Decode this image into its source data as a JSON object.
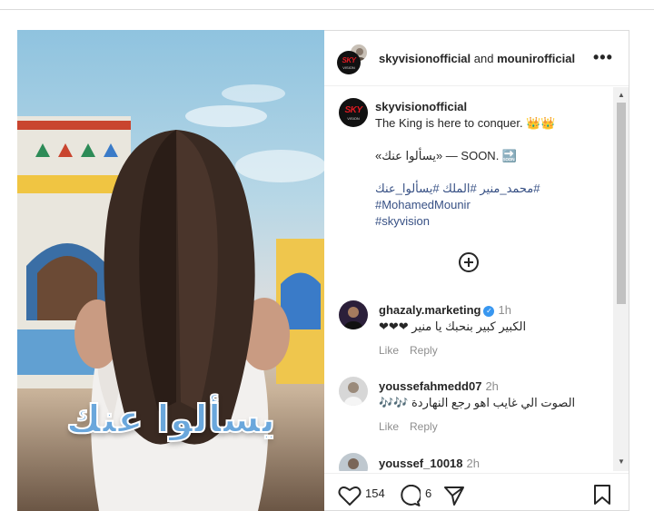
{
  "header": {
    "account_1": "skyvisionofficial",
    "connector": "and",
    "account_2": "mounirofficial",
    "more_icon": "ellipsis-icon"
  },
  "media": {
    "overlay_text": "يسألوا عنك"
  },
  "caption": {
    "username": "skyvisionofficial",
    "line1": "The King is here to conquer. 👑👑",
    "line2": "«يسألوا عنك» — SOON. 🔜",
    "tag1": "#محمد_منير #الملك #يسألوا_عنك",
    "tag2": "#MohamedMounir",
    "tag3": "#skyvision"
  },
  "comments": [
    {
      "username": "ghazaly.marketing",
      "time": "1h",
      "verified": true,
      "text": "الكبير كبير بنحبك يا منير ❤❤❤",
      "like": "Like",
      "reply": "Reply"
    },
    {
      "username": "youssefahmedd07",
      "time": "2h",
      "verified": false,
      "text": "الصوت الي غايب اهو رجع النهاردة 🎶🎶",
      "like": "Like",
      "reply": "Reply"
    },
    {
      "username": "youssef_10018",
      "time": "2h",
      "verified": false
    }
  ],
  "footer": {
    "likes": "154",
    "comments": "6"
  },
  "brand": {
    "sky_logo": "SKY",
    "sky_sub": "VISION",
    "accent": "#e01a22",
    "link_color": "#385185",
    "verified_color": "#3897f0"
  }
}
